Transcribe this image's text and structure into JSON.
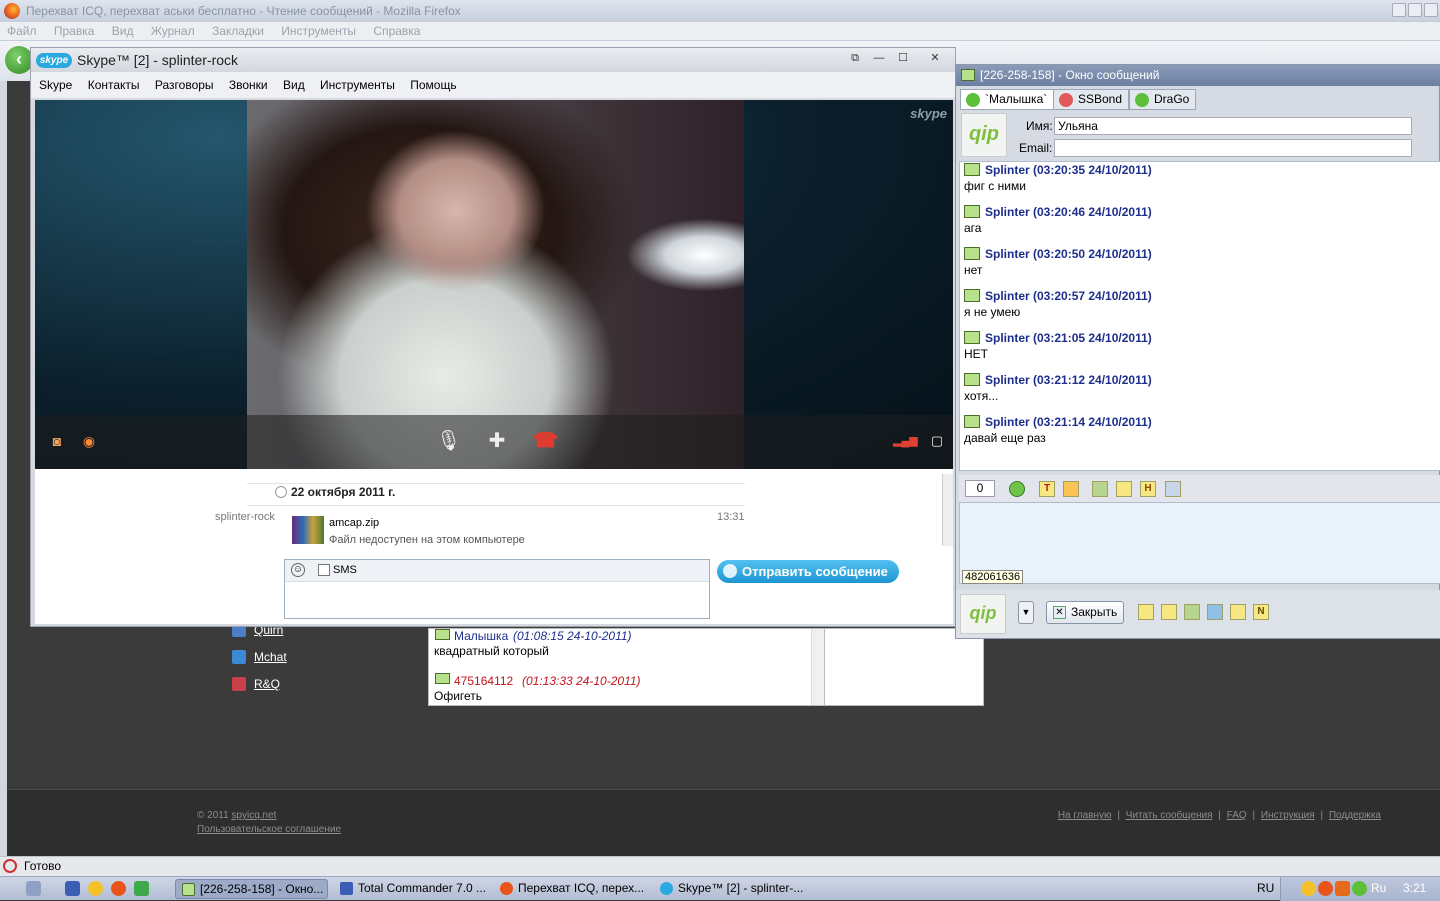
{
  "firefox": {
    "title": "Перехват ICQ, перехват аськи бесплатно - Чтение сообщений - Mozilla Firefox",
    "menu": [
      "Файл",
      "Правка",
      "Вид",
      "Журнал",
      "Закладки",
      "Инструменты",
      "Справка"
    ],
    "status": "Готово"
  },
  "site": {
    "sidebar_links": [
      "Quirn",
      "Mchat",
      "R&Q"
    ],
    "messages": [
      {
        "sender": "Малышка",
        "time": "(01:08:15 24-10-2011)",
        "text": "квадратный который"
      },
      {
        "sender": "475164112",
        "time": "(01:13:33 24-10-2011)",
        "text": "Офигеть"
      }
    ],
    "footer": {
      "copyright_prefix": "© 2011",
      "copyright_link": "spyicq.net",
      "agreement": "Пользовательское соглашение",
      "links": [
        "На главную",
        "Читать сообщения",
        "FAQ",
        "Инструкция",
        "Поддержка"
      ]
    }
  },
  "skype": {
    "logo": "skype",
    "title": "Skype™ [2] - splinter-rock",
    "menu": [
      "Skype",
      "Контакты",
      "Разговоры",
      "Звонки",
      "Вид",
      "Инструменты",
      "Помощь"
    ],
    "watermark": "skype",
    "date": "22 октября 2011 г.",
    "sender": "splinter-rock",
    "file_name": "amcap.zip",
    "file_status": "Файл недоступен на этом компьютере",
    "time": "13:31",
    "sms_label": "SMS",
    "send_label": "Отправить сообщение"
  },
  "qip": {
    "title": "[226-258-158] - Окно сообщений",
    "tabs": [
      "`Малышка`",
      "SSBond",
      "DraGo"
    ],
    "logo": "qip",
    "name_label": "Имя:",
    "name_value": "Ульяна",
    "email_label": "Email:",
    "email_value": "",
    "messages": [
      {
        "header": "Splinter (03:20:35 24/10/2011)",
        "text": "фиг с ними"
      },
      {
        "header": "Splinter (03:20:46 24/10/2011)",
        "text": "ага"
      },
      {
        "header": "Splinter (03:20:50 24/10/2011)",
        "text": "нет"
      },
      {
        "header": "Splinter (03:20:57 24/10/2011)",
        "text": "я не умею"
      },
      {
        "header": "Splinter (03:21:05 24/10/2011)",
        "text": "НЕТ"
      },
      {
        "header": "Splinter (03:21:12 24/10/2011)",
        "text": "хотя..."
      },
      {
        "header": "Splinter (03:21:14 24/10/2011)",
        "text": "давай еще раз"
      }
    ],
    "counter": "0",
    "uin_tooltip": "482061636",
    "close_label": "Закрыть",
    "tool_letters": [
      "T",
      "H",
      "N"
    ]
  },
  "taskbar": {
    "buttons": [
      "[226-258-158] - Окно...",
      "Total Commander 7.0 ...",
      "Перехват ICQ, перех...",
      "Skype™ [2] - splinter-..."
    ],
    "lang": "RU",
    "tray_lang": "Ru",
    "clock": "3:21"
  }
}
